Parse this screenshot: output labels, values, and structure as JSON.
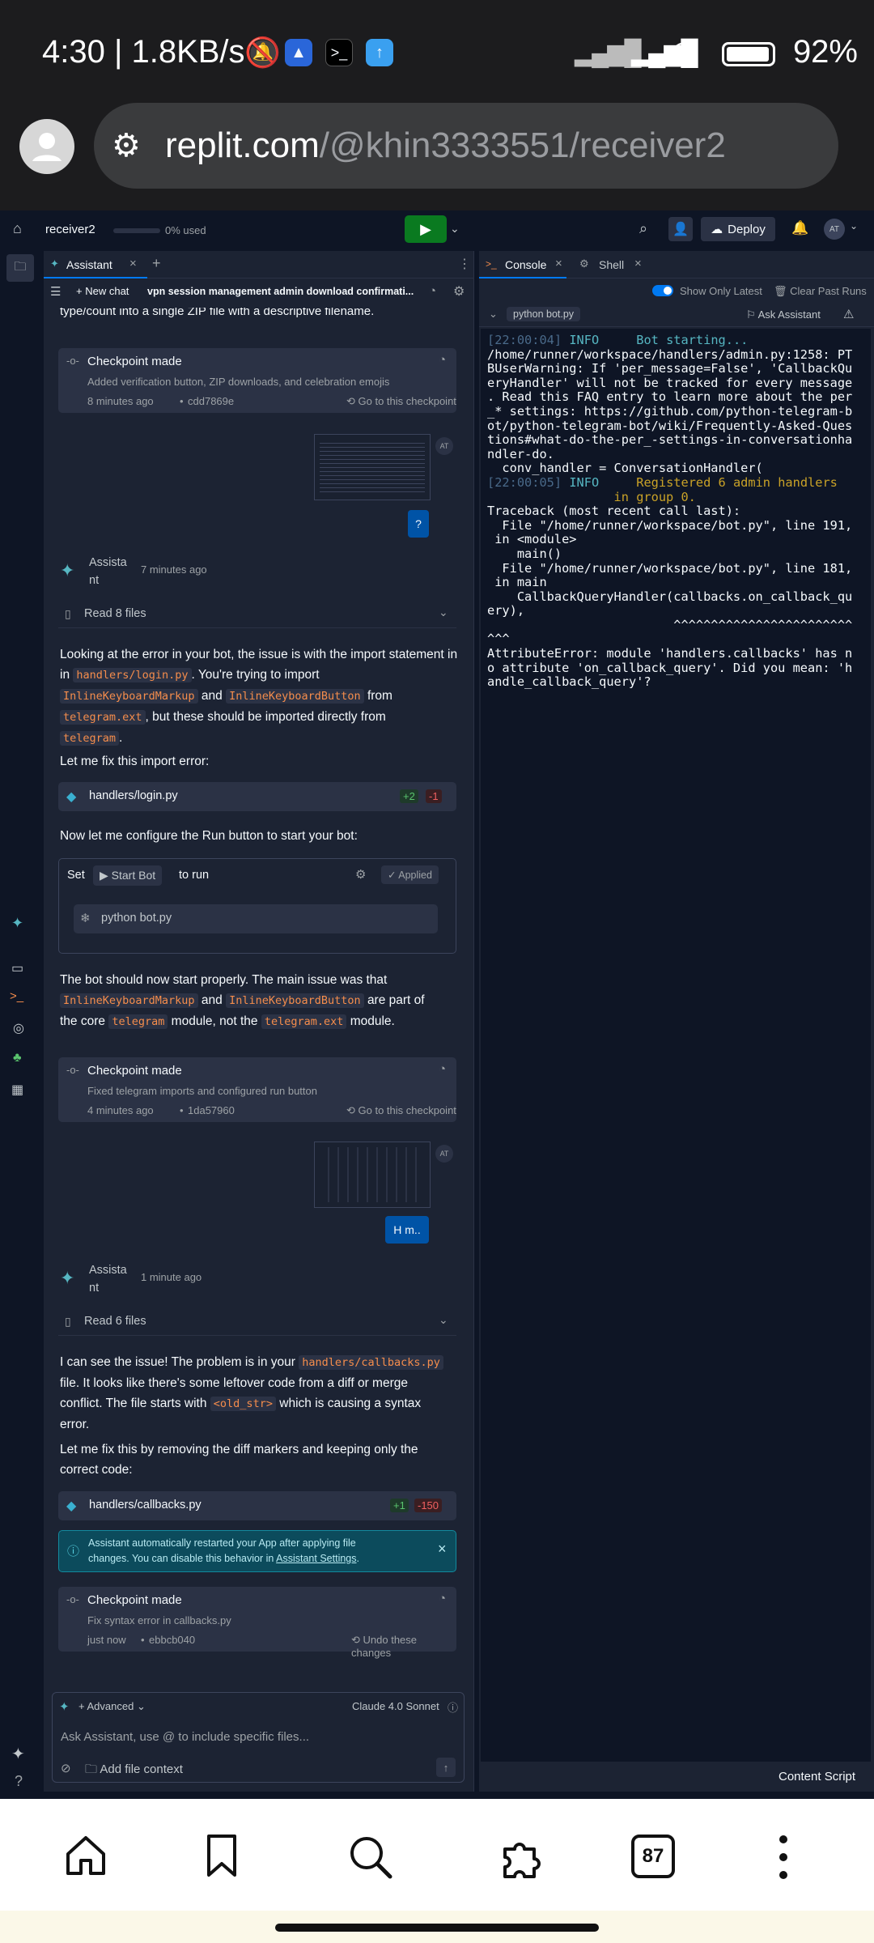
{
  "status": {
    "time": "4:30 | 1.8KB/s",
    "battery": "92%"
  },
  "browser": {
    "url_host": "replit.com",
    "url_path": "/@khin3333551/receiver2",
    "tabs_count": "87"
  },
  "topbar": {
    "repl_name": "receiver2",
    "usage": "0% used",
    "deploy": "Deploy",
    "avatar": "AT"
  },
  "assistant": {
    "tab": "Assistant",
    "new_chat": "New chat",
    "chat_title": "vpn session management admin download confirmati...",
    "prev_text": "type/count into a single ZIP file with a descriptive filename.",
    "cp1": {
      "title": "Checkpoint made",
      "desc": "Added verification button, ZIP downloads, and celebration emojis",
      "time": "8 minutes ago",
      "hash": "cdd7869e",
      "action": "Go to this checkpoint"
    },
    "user_msg1": "?",
    "user_avatar": "AT",
    "asst_name_a": "Assista",
    "asst_name_b": "nt",
    "m1": {
      "time": "7 minutes ago",
      "read": "Read 8 files",
      "p1a": "Looking at the error in your bot, the issue is with the import statement in",
      "p1code1": "handlers/login.py",
      "p1b": ". You're trying to import",
      "p1code2": "InlineKeyboardMarkup",
      "p1and": "and",
      "p1code3": "InlineKeyboardButton",
      "p1from": "from",
      "p1code4": "telegram.ext",
      "p1c": ", but these should be imported directly from",
      "p1code5": "telegram",
      "p1dot": ".",
      "p2": "Let me fix this import error:",
      "file": "handlers/login.py",
      "add": "+2",
      "del": "-1",
      "p3": "Now let me configure the Run button to start your bot:",
      "set": "Set",
      "startbot": "Start Bot",
      "torun": "to run",
      "applied": "Applied",
      "cmd": "python bot.py",
      "p4a": "The bot should now start properly. The main issue was that",
      "p4code1": "InlineKeyboardMarkup",
      "p4and": "and",
      "p4code2": "InlineKeyboardButton",
      "p4b": "are part of",
      "p4c": "the core",
      "p4code3": "telegram",
      "p4d": "module, not the",
      "p4code4": "telegram.ext",
      "p4e": "module."
    },
    "cp2": {
      "title": "Checkpoint made",
      "desc": "Fixed telegram imports and configured run button",
      "time": "4 minutes ago",
      "hash": "1da57960",
      "action": "Go to this checkpoint"
    },
    "user_msg2": "H m..",
    "m2": {
      "time": "1 minute ago",
      "read": "Read 6 files",
      "p1a": "I can see the issue! The problem is in your",
      "p1code": "handlers/callbacks.py",
      "p1b": "file. It looks like there's some leftover code from a diff or merge",
      "p1c": "conflict. The file starts with",
      "p1code2": "<old_str>",
      "p1d": "which is causing a syntax",
      "p1e": "error.",
      "p2a": "Let me fix this by removing the diff markers and keeping only the",
      "p2b": "correct code:",
      "file": "handlers/callbacks.py",
      "add": "+1",
      "del": "-150",
      "notice_a": "Assistant automatically restarted your App after applying file",
      "notice_b": "changes. You can disable this behavior in",
      "notice_link": "Assistant Settings",
      "notice_dot": "."
    },
    "cp3": {
      "title": "Checkpoint made",
      "desc": "Fix syntax error in callbacks.py",
      "time": "just now",
      "hash": "ebbcb040",
      "action": "Undo these changes"
    },
    "input": {
      "advanced": "Advanced",
      "model": "Claude 4.0 Sonnet",
      "placeholder": "Ask Assistant, use @ to include specific files...",
      "context": "Add file context"
    }
  },
  "console": {
    "tab1": "Console",
    "tab2": "Shell",
    "show_latest": "Show Only Latest",
    "clear": "Clear Past Runs",
    "run_label": "python bot.py",
    "ask": "Ask Assistant",
    "lines": [
      {
        "t": "[22:00:04]",
        "lvl": "INFO",
        "msg": "Bot starting..."
      },
      {
        "txt": "/home/runner/workspace/handlers/admin.py:1258: PT"
      },
      {
        "txt": "BUserWarning: If 'per_message=False', 'CallbackQu"
      },
      {
        "txt": "eryHandler' will not be tracked for every message"
      },
      {
        "txt": ". Read this FAQ entry to learn more about the per"
      },
      {
        "txt": "_* settings: https://github.com/python-telegram-b"
      },
      {
        "txt": "ot/python-telegram-bot/wiki/Frequently-Asked-Ques"
      },
      {
        "txt": "tions#what-do-the-per_-settings-in-conversationha"
      },
      {
        "txt": "ndler-do."
      },
      {
        "txt": "  conv_handler = ConversationHandler("
      },
      {
        "t": "[22:00:05]",
        "lvl": "INFO",
        "msg": "Registered 6 admin handlers"
      },
      {
        "txt": "                 in group 0.",
        "warn": true
      },
      {
        "txt": "Traceback (most recent call last):"
      },
      {
        "txt": "  File \"/home/runner/workspace/bot.py\", line 191,"
      },
      {
        "txt": " in <module>"
      },
      {
        "txt": "    main()"
      },
      {
        "txt": "  File \"/home/runner/workspace/bot.py\", line 181,"
      },
      {
        "txt": " in main"
      },
      {
        "txt": "    CallbackQueryHandler(callbacks.on_callback_qu"
      },
      {
        "txt": "ery),"
      },
      {
        "txt": "                         ^^^^^^^^^^^^^^^^^^^^^^^^"
      },
      {
        "txt": "^^^"
      },
      {
        "txt": "AttributeError: module 'handlers.callbacks' has n"
      },
      {
        "txt": "o attribute 'on_callback_query'. Did you mean: 'h"
      },
      {
        "txt": "andle_callback_query'?"
      }
    ],
    "content_script": "Content Script"
  },
  "colors": {
    "accent": "#0079f2",
    "run": "#0a7a20",
    "info": "#56b6c2",
    "warn": "#c9a227"
  }
}
